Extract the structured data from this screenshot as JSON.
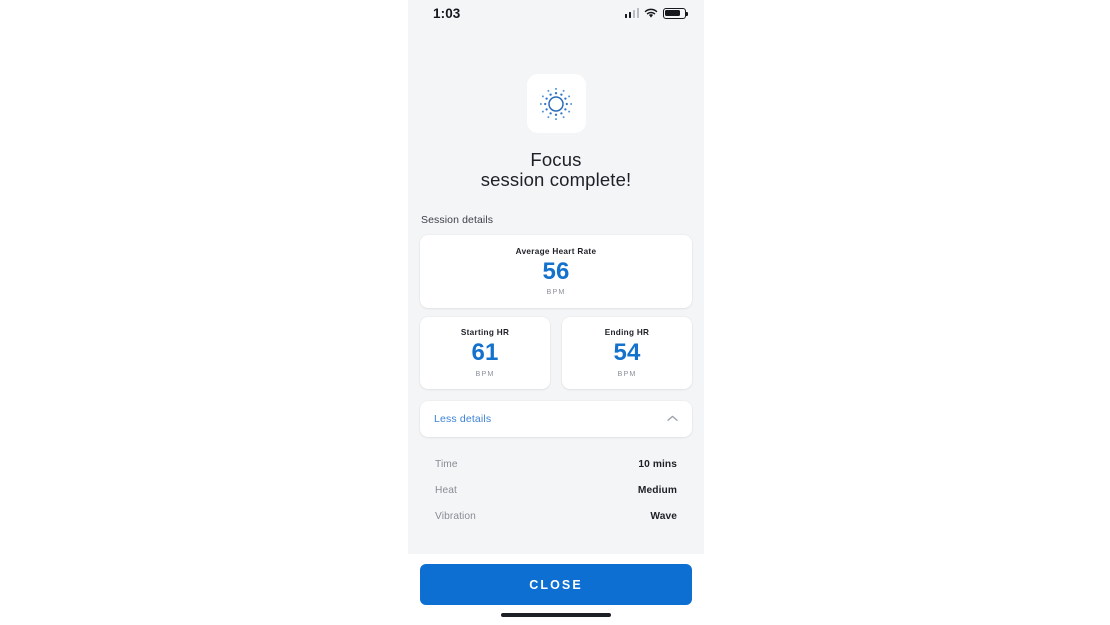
{
  "status_bar": {
    "time": "1:03",
    "icons": [
      "cellular-signal-icon",
      "wifi-icon",
      "battery-icon"
    ]
  },
  "hero": {
    "icon": "focus-sun-icon",
    "title_line1": "Focus",
    "title_line2": "session complete!"
  },
  "session": {
    "section_label": "Session details",
    "average": {
      "title": "Average Heart Rate",
      "value": "56",
      "unit": "BPM"
    },
    "starting": {
      "title": "Starting HR",
      "value": "61",
      "unit": "BPM"
    },
    "ending": {
      "title": "Ending HR",
      "value": "54",
      "unit": "BPM"
    }
  },
  "expander": {
    "label": "Less details",
    "icon": "chevron-up-icon",
    "expanded": true
  },
  "details": [
    {
      "key": "Time",
      "value": "10 mins"
    },
    {
      "key": "Heat",
      "value": "Medium"
    },
    {
      "key": "Vibration",
      "value": "Wave"
    }
  ],
  "footer": {
    "close_label": "CLOSE"
  },
  "colors": {
    "accent_blue": "#1471cc",
    "button_blue": "#0d6fd1",
    "link_blue": "#3d82d6",
    "screen_bg": "#f4f5f7",
    "card_bg": "#ffffff",
    "text_dark": "#1d2026",
    "text_muted": "#878c94"
  }
}
